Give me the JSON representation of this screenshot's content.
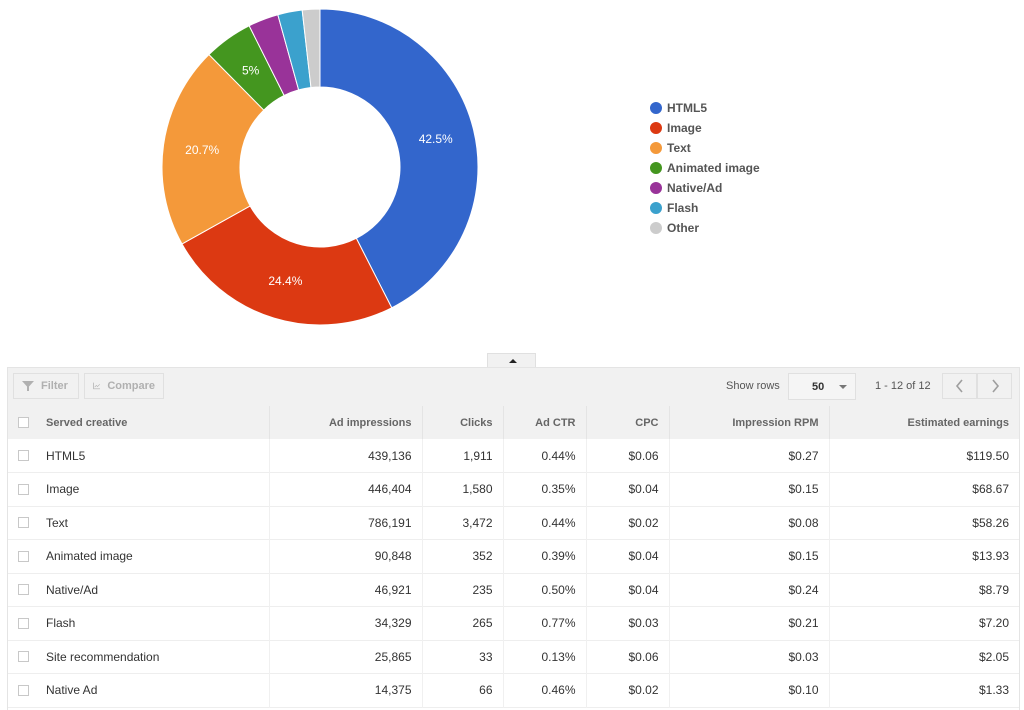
{
  "chart_data": {
    "type": "pie",
    "variant": "donut",
    "title": "",
    "categories": [
      "HTML5",
      "Image",
      "Text",
      "Animated image",
      "Native/Ad",
      "Flash",
      "Other"
    ],
    "values": [
      42.5,
      24.4,
      20.7,
      5.0,
      3.1,
      2.5,
      1.8
    ],
    "slice_labels": [
      "42.5%",
      "24.4%",
      "20.7%",
      "5%",
      "",
      "",
      ""
    ],
    "colors": [
      "#3366cc",
      "#dc3912",
      "#f4993a",
      "#44961f",
      "#993399",
      "#3ba1cd",
      "#cccccc"
    ],
    "legend_position": "right",
    "unit": "percent of estimated earnings"
  },
  "legend": {
    "items": [
      {
        "label": "HTML5",
        "color": "#3366cc"
      },
      {
        "label": "Image",
        "color": "#dc3912"
      },
      {
        "label": "Text",
        "color": "#f4993a"
      },
      {
        "label": "Animated image",
        "color": "#44961f"
      },
      {
        "label": "Native/Ad",
        "color": "#993399"
      },
      {
        "label": "Flash",
        "color": "#3ba1cd"
      },
      {
        "label": "Other",
        "color": "#cccccc"
      }
    ]
  },
  "toolbar": {
    "filter_label": "Filter",
    "compare_label": "Compare",
    "show_rows_label": "Show rows",
    "rows_value": "50",
    "pager_text": "1 - 12 of 12",
    "icons": {
      "filter": "filter-funnel-icon",
      "compare": "line-chart-icon",
      "prev": "chevron-left-icon",
      "next": "chevron-right-icon",
      "collapse": "caret-up-icon"
    }
  },
  "table": {
    "columns": [
      "Served creative",
      "Ad impressions",
      "Clicks",
      "Ad CTR",
      "CPC",
      "Impression RPM",
      "Estimated earnings"
    ],
    "rows": [
      [
        "HTML5",
        "439,136",
        "1,911",
        "0.44%",
        "$0.06",
        "$0.27",
        "$119.50"
      ],
      [
        "Image",
        "446,404",
        "1,580",
        "0.35%",
        "$0.04",
        "$0.15",
        "$68.67"
      ],
      [
        "Text",
        "786,191",
        "3,472",
        "0.44%",
        "$0.02",
        "$0.08",
        "$58.26"
      ],
      [
        "Animated image",
        "90,848",
        "352",
        "0.39%",
        "$0.04",
        "$0.15",
        "$13.93"
      ],
      [
        "Native/Ad",
        "46,921",
        "235",
        "0.50%",
        "$0.04",
        "$0.24",
        "$8.79"
      ],
      [
        "Flash",
        "34,329",
        "265",
        "0.77%",
        "$0.03",
        "$0.21",
        "$7.20"
      ],
      [
        "Site recommendation",
        "25,865",
        "33",
        "0.13%",
        "$0.06",
        "$0.03",
        "$2.05"
      ],
      [
        "Native Ad",
        "14,375",
        "66",
        "0.46%",
        "$0.02",
        "$0.10",
        "$1.33"
      ]
    ]
  }
}
